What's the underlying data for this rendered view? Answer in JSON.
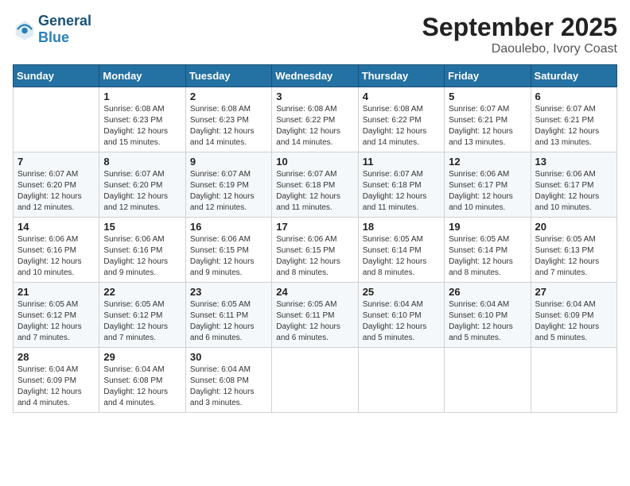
{
  "logo": {
    "general": "General",
    "blue": "Blue"
  },
  "title": "September 2025",
  "subtitle": "Daoulebo, Ivory Coast",
  "days_header": [
    "Sunday",
    "Monday",
    "Tuesday",
    "Wednesday",
    "Thursday",
    "Friday",
    "Saturday"
  ],
  "weeks": [
    [
      {
        "day": "",
        "info": ""
      },
      {
        "day": "1",
        "info": "Sunrise: 6:08 AM\nSunset: 6:23 PM\nDaylight: 12 hours\nand 15 minutes."
      },
      {
        "day": "2",
        "info": "Sunrise: 6:08 AM\nSunset: 6:23 PM\nDaylight: 12 hours\nand 14 minutes."
      },
      {
        "day": "3",
        "info": "Sunrise: 6:08 AM\nSunset: 6:22 PM\nDaylight: 12 hours\nand 14 minutes."
      },
      {
        "day": "4",
        "info": "Sunrise: 6:08 AM\nSunset: 6:22 PM\nDaylight: 12 hours\nand 14 minutes."
      },
      {
        "day": "5",
        "info": "Sunrise: 6:07 AM\nSunset: 6:21 PM\nDaylight: 12 hours\nand 13 minutes."
      },
      {
        "day": "6",
        "info": "Sunrise: 6:07 AM\nSunset: 6:21 PM\nDaylight: 12 hours\nand 13 minutes."
      }
    ],
    [
      {
        "day": "7",
        "info": "Sunrise: 6:07 AM\nSunset: 6:20 PM\nDaylight: 12 hours\nand 12 minutes."
      },
      {
        "day": "8",
        "info": "Sunrise: 6:07 AM\nSunset: 6:20 PM\nDaylight: 12 hours\nand 12 minutes."
      },
      {
        "day": "9",
        "info": "Sunrise: 6:07 AM\nSunset: 6:19 PM\nDaylight: 12 hours\nand 12 minutes."
      },
      {
        "day": "10",
        "info": "Sunrise: 6:07 AM\nSunset: 6:18 PM\nDaylight: 12 hours\nand 11 minutes."
      },
      {
        "day": "11",
        "info": "Sunrise: 6:07 AM\nSunset: 6:18 PM\nDaylight: 12 hours\nand 11 minutes."
      },
      {
        "day": "12",
        "info": "Sunrise: 6:06 AM\nSunset: 6:17 PM\nDaylight: 12 hours\nand 10 minutes."
      },
      {
        "day": "13",
        "info": "Sunrise: 6:06 AM\nSunset: 6:17 PM\nDaylight: 12 hours\nand 10 minutes."
      }
    ],
    [
      {
        "day": "14",
        "info": "Sunrise: 6:06 AM\nSunset: 6:16 PM\nDaylight: 12 hours\nand 10 minutes."
      },
      {
        "day": "15",
        "info": "Sunrise: 6:06 AM\nSunset: 6:16 PM\nDaylight: 12 hours\nand 9 minutes."
      },
      {
        "day": "16",
        "info": "Sunrise: 6:06 AM\nSunset: 6:15 PM\nDaylight: 12 hours\nand 9 minutes."
      },
      {
        "day": "17",
        "info": "Sunrise: 6:06 AM\nSunset: 6:15 PM\nDaylight: 12 hours\nand 8 minutes."
      },
      {
        "day": "18",
        "info": "Sunrise: 6:05 AM\nSunset: 6:14 PM\nDaylight: 12 hours\nand 8 minutes."
      },
      {
        "day": "19",
        "info": "Sunrise: 6:05 AM\nSunset: 6:14 PM\nDaylight: 12 hours\nand 8 minutes."
      },
      {
        "day": "20",
        "info": "Sunrise: 6:05 AM\nSunset: 6:13 PM\nDaylight: 12 hours\nand 7 minutes."
      }
    ],
    [
      {
        "day": "21",
        "info": "Sunrise: 6:05 AM\nSunset: 6:12 PM\nDaylight: 12 hours\nand 7 minutes."
      },
      {
        "day": "22",
        "info": "Sunrise: 6:05 AM\nSunset: 6:12 PM\nDaylight: 12 hours\nand 7 minutes."
      },
      {
        "day": "23",
        "info": "Sunrise: 6:05 AM\nSunset: 6:11 PM\nDaylight: 12 hours\nand 6 minutes."
      },
      {
        "day": "24",
        "info": "Sunrise: 6:05 AM\nSunset: 6:11 PM\nDaylight: 12 hours\nand 6 minutes."
      },
      {
        "day": "25",
        "info": "Sunrise: 6:04 AM\nSunset: 6:10 PM\nDaylight: 12 hours\nand 5 minutes."
      },
      {
        "day": "26",
        "info": "Sunrise: 6:04 AM\nSunset: 6:10 PM\nDaylight: 12 hours\nand 5 minutes."
      },
      {
        "day": "27",
        "info": "Sunrise: 6:04 AM\nSunset: 6:09 PM\nDaylight: 12 hours\nand 5 minutes."
      }
    ],
    [
      {
        "day": "28",
        "info": "Sunrise: 6:04 AM\nSunset: 6:09 PM\nDaylight: 12 hours\nand 4 minutes."
      },
      {
        "day": "29",
        "info": "Sunrise: 6:04 AM\nSunset: 6:08 PM\nDaylight: 12 hours\nand 4 minutes."
      },
      {
        "day": "30",
        "info": "Sunrise: 6:04 AM\nSunset: 6:08 PM\nDaylight: 12 hours\nand 3 minutes."
      },
      {
        "day": "",
        "info": ""
      },
      {
        "day": "",
        "info": ""
      },
      {
        "day": "",
        "info": ""
      },
      {
        "day": "",
        "info": ""
      }
    ]
  ]
}
